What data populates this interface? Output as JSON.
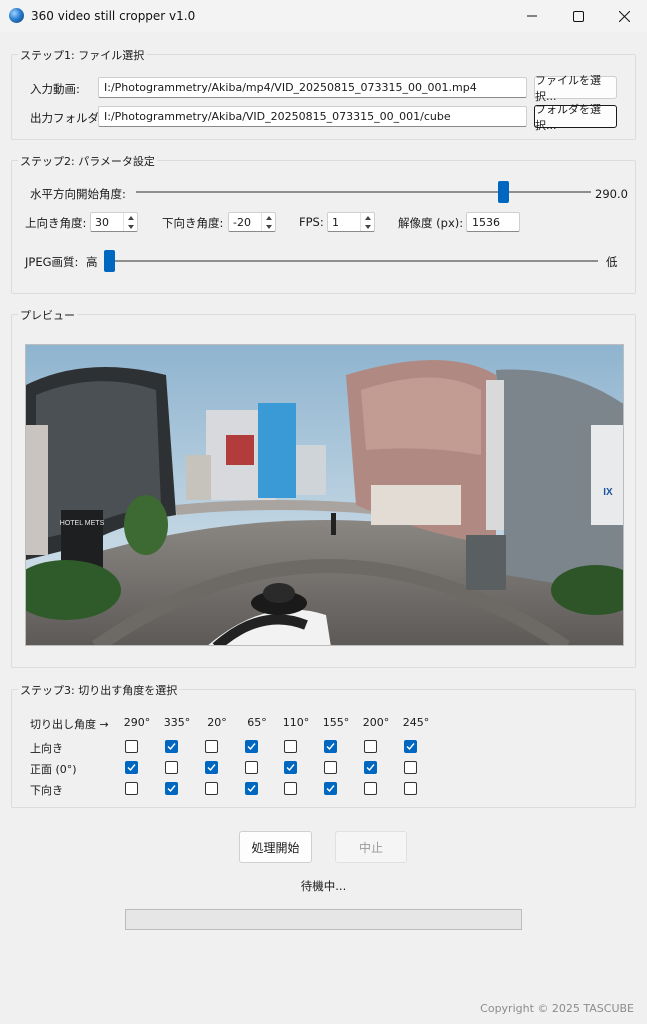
{
  "window": {
    "title": "360 video still cropper v1.0",
    "icon": "app-globe-icon",
    "controls": [
      "minimize-icon",
      "maximize-icon",
      "close-icon"
    ]
  },
  "step1": {
    "title": "ステップ1: ファイル選択",
    "input_label": "入力動画:",
    "input_value": "I:/Photogrammetry/Akiba/mp4/VID_20250815_073315_00_001.mp4",
    "input_button": "ファイルを選択...",
    "output_label": "出力フォルダ:",
    "output_value": "I:/Photogrammetry/Akiba/VID_20250815_073315_00_001/cube",
    "output_button": "フォルダを選択..."
  },
  "step2": {
    "title": "ステップ2: パラメータ設定",
    "h_angle_label": "水平方向開始角度:",
    "h_angle_value": "290.0",
    "h_angle_level": 0.806,
    "up_label": "上向き角度:",
    "up_value": "30",
    "down_label": "下向き角度:",
    "down_value": "-20",
    "fps_label": "FPS:",
    "fps_value": "1",
    "res_label": "解像度 (px):",
    "res_value": "1536",
    "jpeg_label": "JPEG画質:",
    "jpeg_high": "高",
    "jpeg_low": "低",
    "jpeg_level": 0.0
  },
  "preview": {
    "title": "プレビュー",
    "hotel_sign": "HOTEL METS",
    "store_sign": "IX"
  },
  "step3": {
    "title": "ステップ3: 切り出す角度を選択",
    "header_label": "切り出し角度 →",
    "angles": [
      "290°",
      "335°",
      "20°",
      "65°",
      "110°",
      "155°",
      "200°",
      "245°"
    ],
    "rows": [
      {
        "label": "上向き",
        "checks": [
          false,
          true,
          false,
          true,
          false,
          true,
          false,
          true
        ]
      },
      {
        "label": "正面 (0°)",
        "checks": [
          true,
          false,
          true,
          false,
          true,
          false,
          true,
          false
        ]
      },
      {
        "label": "下向き",
        "checks": [
          false,
          true,
          false,
          true,
          false,
          true,
          false,
          false
        ]
      }
    ]
  },
  "actions": {
    "start": "処理開始",
    "stop": "中止"
  },
  "status": "待機中...",
  "progress_level": 0.0,
  "copyright": "Copyright © 2025 TASCUBE",
  "colors": {
    "accent": "#0067c0",
    "window_bg": "#f0f0f0"
  }
}
